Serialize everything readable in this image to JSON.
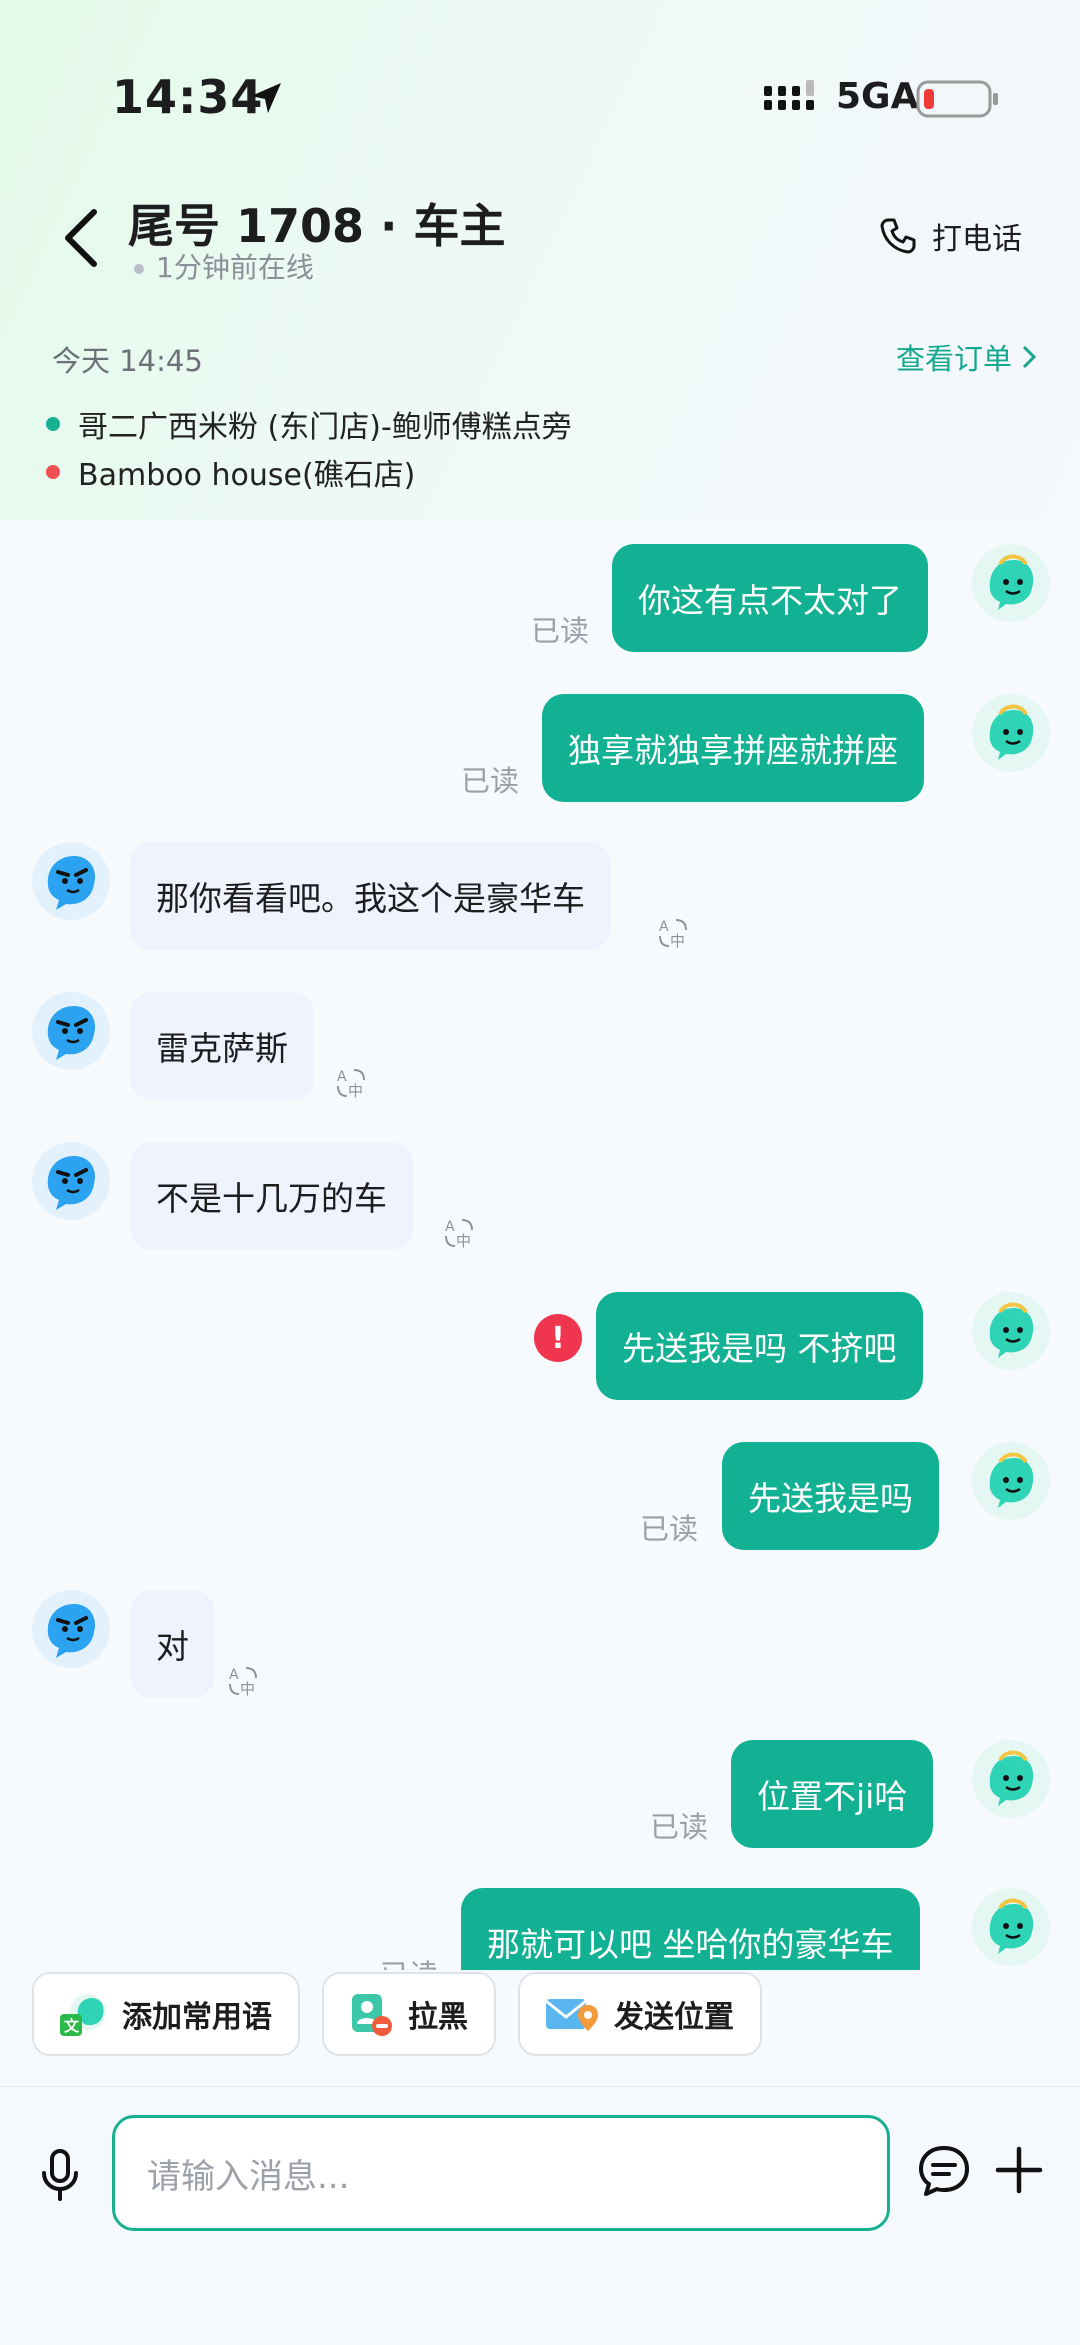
{
  "status_bar": {
    "time": "14:34",
    "network": "5GA"
  },
  "header": {
    "title": "尾号 1708 · 车主",
    "online": "1分钟前在线",
    "call_label": "打电话"
  },
  "order": {
    "time": "今天 14:45",
    "link_label": "查看订单",
    "from": "哥二广西米粉 (东门店)-鲍师傅糕点旁",
    "to": "Bamboo house(礁石店)"
  },
  "messages": [
    {
      "side": "out",
      "text": "你这有点不太对了",
      "status": "已读"
    },
    {
      "side": "out",
      "text": "独享就独享拼座就拼座",
      "status": "已读"
    },
    {
      "side": "in",
      "text": "那你看看吧。我这个是豪华车"
    },
    {
      "side": "in",
      "text": "雷克萨斯"
    },
    {
      "side": "in",
      "text": "不是十几万的车"
    },
    {
      "side": "out",
      "text": "先送我是吗 不挤吧",
      "status": "failed"
    },
    {
      "side": "out",
      "text": "先送我是吗",
      "status": "已读"
    },
    {
      "side": "in",
      "text": "对"
    },
    {
      "side": "out",
      "text": "位置不ji哈",
      "status": "已读"
    },
    {
      "side": "out",
      "text": "那就可以吧 坐哈你的豪华车",
      "status": "已读"
    }
  ],
  "quick_actions": [
    {
      "label": "添加常用语",
      "icon": "common-phrase-icon"
    },
    {
      "label": "拉黑",
      "icon": "block-user-icon"
    },
    {
      "label": "发送位置",
      "icon": "send-location-icon"
    }
  ],
  "input": {
    "placeholder": "请输入消息..."
  },
  "colors": {
    "accent": "#12b193",
    "error": "#f0364f",
    "incoming_bubble": "#eef3fd"
  }
}
